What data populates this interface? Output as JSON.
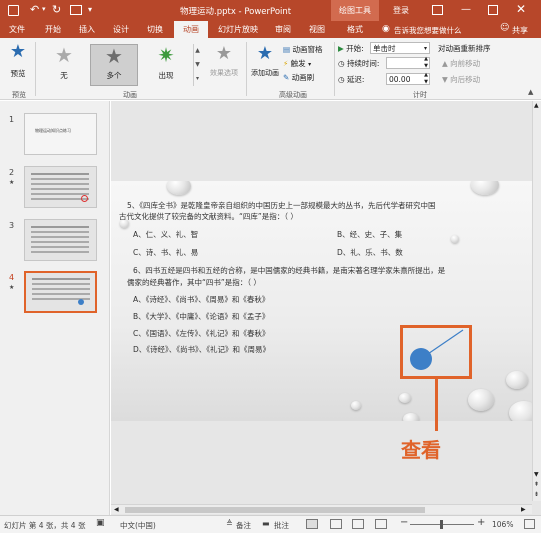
{
  "titlebar": {
    "filename": "物理运动.pptx - PowerPoint",
    "context_tool": "绘图工具",
    "login": "登录"
  },
  "tabs": [
    "文件",
    "开始",
    "插入",
    "设计",
    "切换",
    "动画",
    "幻灯片放映",
    "审阅",
    "视图",
    "格式"
  ],
  "tell_me": "告诉我您想要做什么",
  "share": "共享",
  "ribbon": {
    "preview_label": "预览",
    "group_preview": "预览",
    "group_animation": "动画",
    "group_advanced": "高级动画",
    "group_timing": "计时",
    "effects": [
      "无",
      "多个",
      "出现"
    ],
    "effect_options": "效果选项",
    "add_animation": "添加动画",
    "animation_pane": "动画窗格",
    "trigger": "触发",
    "animation_painter": "动画刷",
    "start_label": "开始:",
    "start_value": "单击时",
    "duration_label": "持续时间:",
    "delay_label": "延迟:",
    "delay_value": "00.00",
    "reorder_title": "对动画重新排序",
    "move_earlier": "向前移动",
    "move_later": "向后移动"
  },
  "thumbnails": [
    {
      "num": "1",
      "title": "物理运动知识点练习"
    },
    {
      "num": "2",
      "star": "★"
    },
    {
      "num": "3"
    },
    {
      "num": "4",
      "star": "★"
    }
  ],
  "slide": {
    "q5": "5、《四库全书》是乾隆皇帝亲自组织的中国历史上一部规模最大的丛书，先后代学者研究中国",
    "q5b": "古代文化提供了较完备的文献资料。“四库”是指：（  ）",
    "q5_options": [
      "A、仁、义、礼、智",
      "B、经、史、子、集",
      "C、诗、书、礼、易",
      "D、礼、乐、书、数"
    ],
    "q6": "6、四书五经是四书和五经的合称，是中国儒家的经典书籍，是南宋著名理学家朱熹所提出，是",
    "q6b": "儒家的经典著作，其中“四书”是指：（  ）",
    "q6_options": [
      "A、《诗经》、《尚书》、《周易》和《春秋》",
      "B、《大学》、《中庸》、《论语》和《孟子》",
      "C、《国语》、《左传》、《礼记》和《春秋》",
      "D、《诗经》、《尚书》、《礼记》和《周易》"
    ]
  },
  "callout": "查看",
  "status": {
    "slide_info": "幻灯片 第 4 张，共 4 张",
    "language": "中文(中国)",
    "notes": "备注",
    "comments": "批注",
    "zoom": "106%"
  },
  "colors": {
    "accent": "#b7472a",
    "callout": "#e0632a",
    "marker": "#3d7fc7"
  }
}
